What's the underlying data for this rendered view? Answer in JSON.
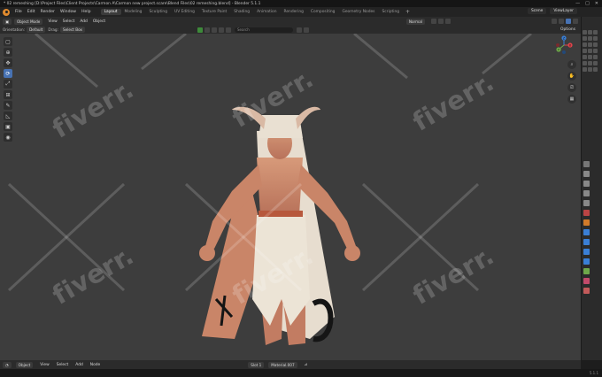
{
  "titlebar": {
    "title": "* 02 remeshing [D:\\Project Files\\Client Projects\\Carmon A\\Carmon new project.scare\\Blend Files\\02 remeshing.blend] - Blender 5.1.1",
    "window_controls": [
      "—",
      "□",
      "✕"
    ]
  },
  "menubar": {
    "items": [
      "File",
      "Edit",
      "Render",
      "Window",
      "Help"
    ],
    "workspaces": [
      "Layout",
      "Modeling",
      "Sculpting",
      "UV Editing",
      "Texture Paint",
      "Shading",
      "Animation",
      "Rendering",
      "Compositing",
      "Geometry Nodes",
      "Scripting"
    ],
    "active_workspace": "Layout",
    "scene_label": "Scene",
    "viewlayer_label": "ViewLayer"
  },
  "viewport_header": {
    "mode": "Object Mode",
    "menus": [
      "View",
      "Select",
      "Add",
      "Object"
    ],
    "transform_orientation": "Normal"
  },
  "tool_header": {
    "orientation_label": "Orientation:",
    "orientation_value": "Default",
    "drag_label": "Drag:",
    "drag_value": "Select Box",
    "search_placeholder": "Search",
    "options_label": "Options"
  },
  "toolbar": {
    "tools": [
      "cursor-select",
      "cursor",
      "move",
      "rotate",
      "scale",
      "transform",
      "annotate",
      "measure",
      "add-cube",
      "camera"
    ]
  },
  "watermark": {
    "text": "fiverr."
  },
  "gizmo": {
    "x": "X",
    "y": "Y",
    "z": "Z",
    "colors": {
      "x": "#e0444b",
      "y": "#6ea84a",
      "z": "#3a7fd6"
    }
  },
  "bottom_header": {
    "editor_type": "Object",
    "menus": [
      "View",
      "Select",
      "Add",
      "Node"
    ],
    "slot": "Slot 1",
    "material": "Material.007"
  },
  "statusbar": {
    "version": "5.1.1"
  },
  "colors": {
    "accent": "#4772b3",
    "viewport_bg": "#3d3d3d",
    "logo": "#e08a2e"
  }
}
